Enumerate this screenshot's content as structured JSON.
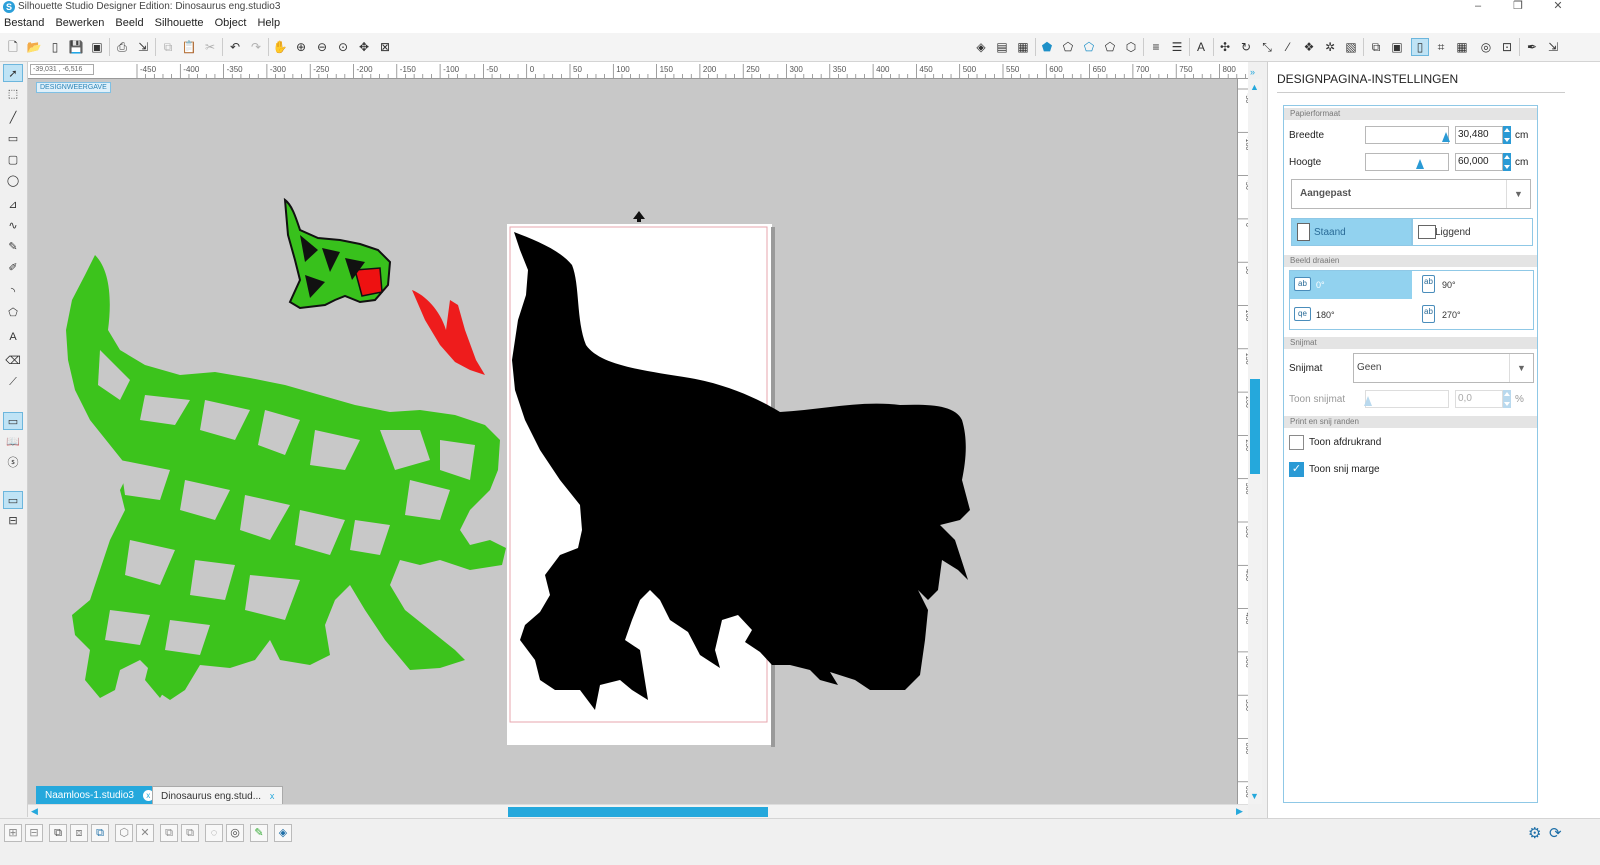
{
  "window": {
    "title": "Silhouette Studio Designer Edition: Dinosaurus eng.studio3",
    "minimize": "–",
    "restore": "❐",
    "close": "✕"
  },
  "menu": [
    "Bestand",
    "Bewerken",
    "Beeld",
    "Silhouette",
    "Object",
    "Help"
  ],
  "ruler": {
    "h_labels": [
      "-450",
      "-400",
      "-350",
      "-300",
      "-250",
      "-200",
      "-150",
      "-100",
      "-50",
      "0",
      "50",
      "100",
      "150",
      "200",
      "250",
      "300",
      "350",
      "400",
      "450",
      "500",
      "550",
      "600",
      "650",
      "700",
      "750",
      "800"
    ],
    "v_labels": [
      "-50",
      "-100",
      "-50",
      "0",
      "50",
      "100",
      "150",
      "200",
      "250",
      "300",
      "350",
      "400",
      "450",
      "500",
      "550",
      "600",
      "650"
    ]
  },
  "canvas": {
    "coordinates": "-39,031 , -6,516",
    "design_view_label": "DESIGNWEERGAVE"
  },
  "tabs": [
    {
      "label": "Naamloos-1.studio3",
      "close": "x"
    },
    {
      "label": "Dinosaurus eng.stud...",
      "close": "x"
    }
  ],
  "panel": {
    "title": "DESIGNPAGINA-INSTELLINGEN",
    "paper_section": "Papierformaat",
    "width_label": "Breedte",
    "width_value": "30,480",
    "width_unit": "cm",
    "height_label": "Hoogte",
    "height_value": "60,000",
    "height_unit": "cm",
    "size_preset": "Aangepast",
    "orientation_portrait": "Staand",
    "orientation_landscape": "Liggend",
    "rotate_section": "Beeld draaien",
    "rot_0": "0°",
    "rot_90": "90°",
    "rot_180": "180°",
    "rot_270": "270°",
    "rot_0_icon": "ab",
    "rot_90_icon": "ab",
    "rot_180_icon": "qe",
    "rot_270_icon": "ab",
    "mat_section": "Snijmat",
    "mat_label": "Snijmat",
    "mat_value": "Geen",
    "show_mat_label": "Toon snijmat",
    "show_mat_value": "0,0",
    "show_mat_unit": "%",
    "print_section": "Print en snij randen",
    "show_print_border": "Toon afdrukrand",
    "show_print_border_checked": false,
    "show_cut_margin": "Toon snij marge",
    "show_cut_margin_checked": true
  },
  "colors": {
    "accent": "#25a8dc",
    "canvas": "#c8c8c8",
    "dino_green": "#3cc31c",
    "dino_red": "#ee1c1c",
    "silhouette": "#000000"
  }
}
